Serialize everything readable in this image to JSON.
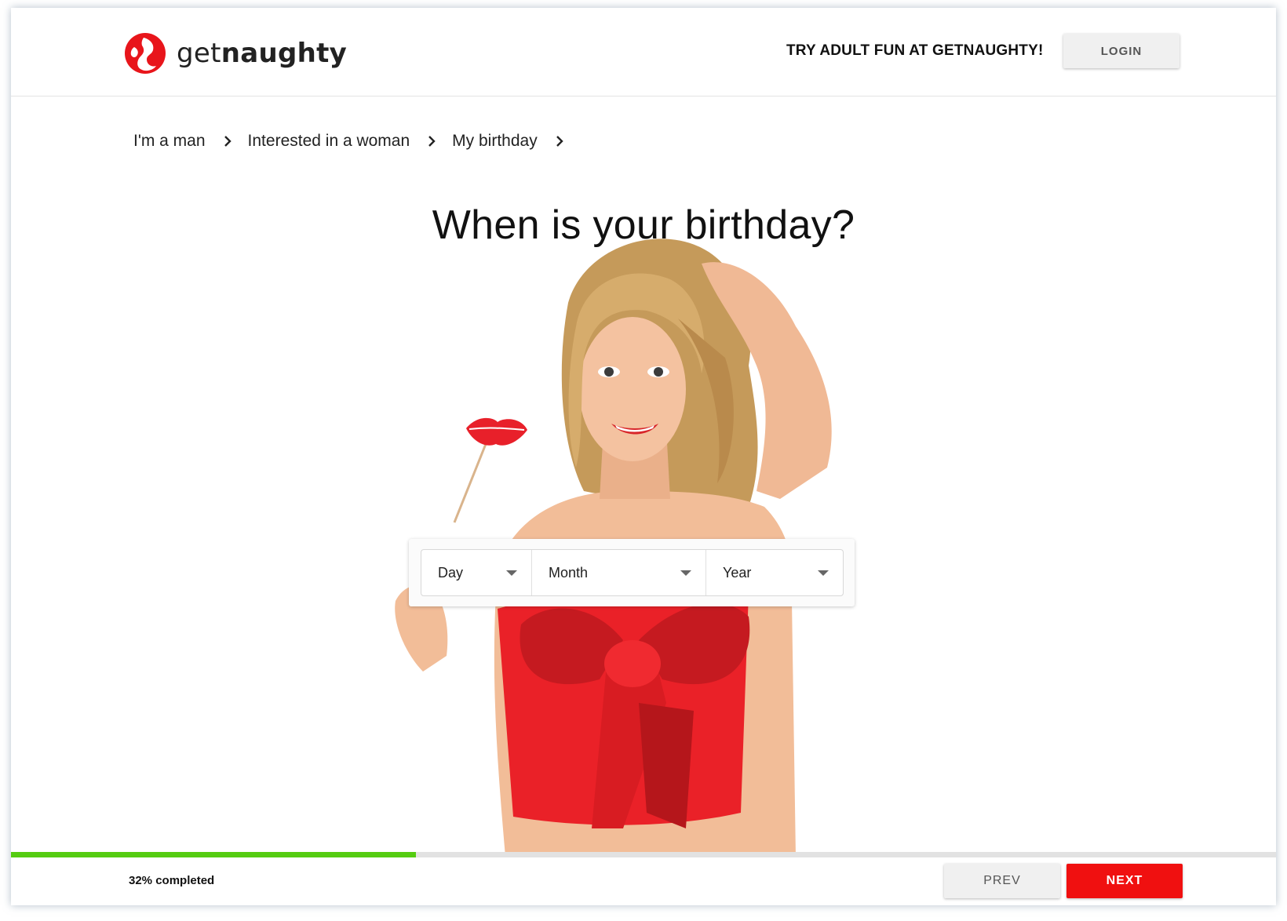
{
  "header": {
    "logo_part1": "get",
    "logo_part2": "naughty",
    "logo_icon": "flame-silhouette-icon",
    "tagline": "TRY ADULT FUN AT GETNAUGHTY!",
    "login_label": "LOGIN"
  },
  "breadcrumb": {
    "items": [
      "I'm a man",
      "Interested in a woman",
      "My birthday"
    ],
    "separator_icon": "chevron-right-icon"
  },
  "page_title": "When is your birthday?",
  "birthday_form": {
    "day_placeholder": "Day",
    "month_placeholder": "Month",
    "year_placeholder": "Year",
    "dropdown_icon": "caret-down-icon"
  },
  "progress": {
    "percent": 32,
    "label": "32% completed"
  },
  "footer": {
    "prev_label": "PREV",
    "next_label": "NEXT"
  },
  "colors": {
    "brand_red": "#f01010",
    "progress_green": "#55cc11",
    "button_gray": "#f0f0f0"
  }
}
